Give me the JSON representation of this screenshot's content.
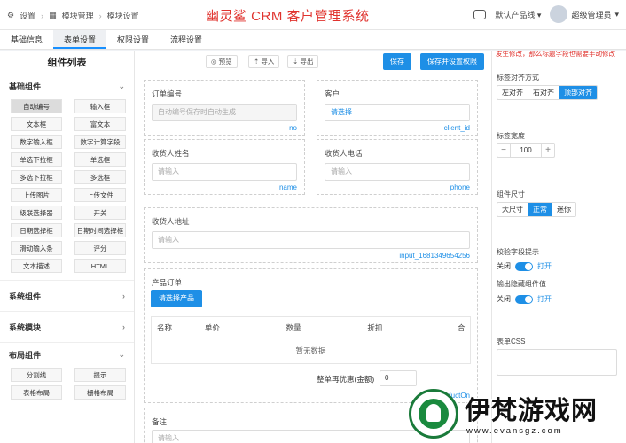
{
  "topbar": {
    "breadcrumb": [
      "设置",
      "模块管理",
      "模块设置"
    ],
    "app_title": "幽灵鲨 CRM 客户管理系统",
    "product_line": "默认产品线",
    "user": "超级管理员"
  },
  "tabs": [
    "基础信息",
    "表单设置",
    "权限设置",
    "流程设置"
  ],
  "left": {
    "title": "组件列表",
    "groups": [
      {
        "name": "基础组件",
        "items": [
          "自动编号",
          "输入框",
          "文本框",
          "富文本",
          "数字输入框",
          "数字计算字段",
          "单选下拉框",
          "单选框",
          "多选下拉框",
          "多选框",
          "上传图片",
          "上传文件",
          "级联选择器",
          "开关",
          "日期选择框",
          "日期时间选择框",
          "滑动输入条",
          "评分",
          "文本描述",
          "HTML"
        ]
      },
      {
        "name": "系统组件"
      },
      {
        "name": "系统模块"
      },
      {
        "name": "布局组件",
        "items": [
          "分割线",
          "提示",
          "表格布局",
          "栅格布局"
        ]
      }
    ]
  },
  "toolbar": {
    "preview": "预览",
    "import": "导入",
    "export": "导出",
    "save": "保存",
    "save_sync": "保存并设置权限"
  },
  "form": {
    "order_no": {
      "label": "订单编号",
      "placeholder": "自动编号保存时自动生成",
      "key": "no"
    },
    "customer": {
      "label": "客户",
      "value": "请选择",
      "key": "client_id"
    },
    "recv_name": {
      "label": "收货人姓名",
      "placeholder": "请输入",
      "key": "name"
    },
    "recv_phone": {
      "label": "收货人电话",
      "placeholder": "请输入",
      "key": "phone"
    },
    "recv_addr": {
      "label": "收货人地址",
      "placeholder": "请输入",
      "key": "input_1681349654256"
    },
    "product": {
      "label": "产品订单",
      "button": "请选择产品",
      "columns": [
        "名称",
        "单价",
        "数量",
        "折扣",
        "合"
      ],
      "empty": "暂无数据",
      "discount_label": "整单再优惠(金额)",
      "discount_value": "0",
      "key": "productOn"
    },
    "remark": {
      "label": "备注",
      "placeholder": "请输入"
    }
  },
  "right": {
    "warning": "发生修改，那么标题字段也需要手动修改",
    "label_align": {
      "title": "标签对齐方式",
      "options": [
        "左对齐",
        "右对齐",
        "顶部对齐"
      ],
      "selected": "顶部对齐"
    },
    "label_width": {
      "title": "标签宽度",
      "value": "100"
    },
    "size": {
      "title": "组件尺寸",
      "options": [
        "大尺寸",
        "正常",
        "迷你"
      ],
      "selected": "正常"
    },
    "verify_hint": {
      "title": "校验字段提示",
      "off": "关闭",
      "on": "打开"
    },
    "hidden_output": {
      "title": "输出隐藏组件值",
      "off": "关闭",
      "on": "打开"
    },
    "css": {
      "title": "表单CSS"
    }
  },
  "watermark": {
    "text": "伊梵游戏网",
    "url": "www.evansgz.com"
  }
}
